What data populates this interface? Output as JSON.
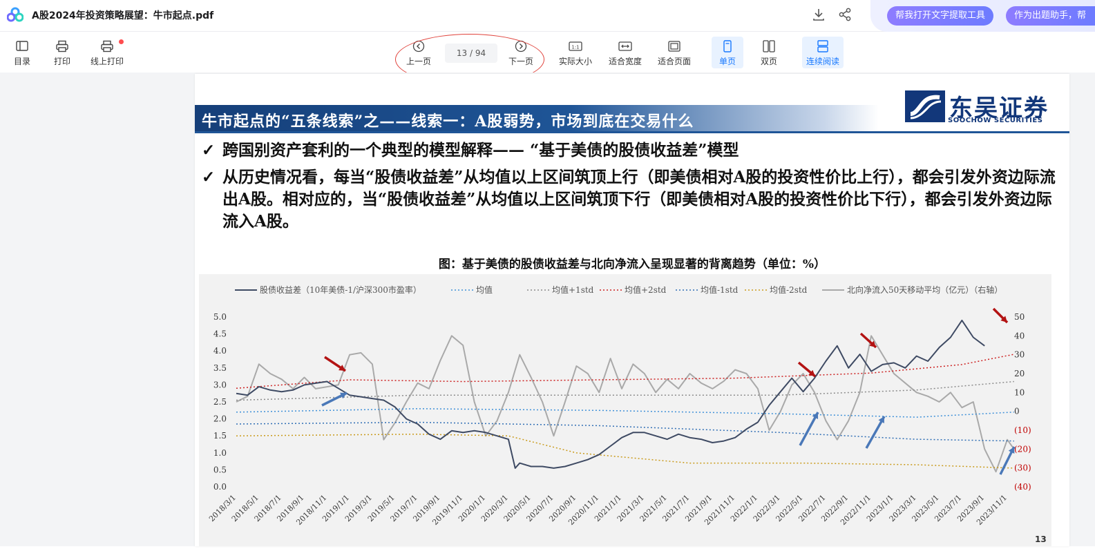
{
  "app": {
    "doc_title": "A股2024年投资策略展望：牛市起点.pdf"
  },
  "top_actions": {
    "assist_text_tool": "帮我打开文字提取工具",
    "assist_question": "作为出题助手，帮"
  },
  "toolbar": {
    "toc": "目录",
    "print": "打印",
    "online_print": "线上打印",
    "prev": "上一页",
    "page_indicator": "13 / 94",
    "next": "下一页",
    "actual_size": "实际大小",
    "fit_width": "适合宽度",
    "fit_page": "适合页面",
    "single": "单页",
    "double": "双页",
    "continuous": "连续阅读"
  },
  "slide": {
    "banner": "牛市起点的“五条线索”之——线索一：A股弱势，市场到底在交易什么",
    "brand_name": "东吴证券",
    "brand_en": "SOOCHOW SECURITIES",
    "check": "✓",
    "bullet1": "跨国别资产套利的一个典型的模型解释——  “基于美债的股债收益差”模型",
    "bullet2": "从历史情况看，每当“股债收益差”从均值以上区间筑顶上行（即美债相对A股的投资性价比上行），都会引发外资边际流出A股。相对应的，当“股债收益差”从均值以上区间筑顶下行（即美债相对A股的投资性价比下行），都会引发外资边际流入A股。",
    "fig_title": "图：基于美债的股债收益差与北向净流入呈现显著的背离趋势（单位：%）",
    "page_num": "13"
  },
  "colors": {
    "ebp": "#3e4a63",
    "mean": "#3c8fd8",
    "p1": "#8a8a8a",
    "p2": "#cc1f1f",
    "m1": "#2e6db4",
    "m2": "#c99a1a",
    "flow": "#a9a9a9",
    "red_arrow": "#b31313",
    "blue_arrow": "#4a78b8",
    "neg_tick": "#c00000"
  },
  "chart_data": {
    "type": "line",
    "legend": [
      "股债收益差（10年美债-1/沪深300市盈率）",
      "均值",
      "均值+1std",
      "均值+2std",
      "均值-1std",
      "均值-2std",
      "北向净流入50天移动平均（亿元）（右轴）"
    ],
    "x_ticks": [
      "2018/3/1",
      "2018/5/1",
      "2018/7/1",
      "2018/9/1",
      "2018/11/1",
      "2019/1/1",
      "2019/3/1",
      "2019/5/1",
      "2019/7/1",
      "2019/9/1",
      "2019/11/1",
      "2020/1/1",
      "2020/3/1",
      "2020/5/1",
      "2020/7/1",
      "2020/9/1",
      "2020/11/1",
      "2021/1/1",
      "2021/3/1",
      "2021/5/1",
      "2021/7/1",
      "2021/9/1",
      "2021/11/1",
      "2022/1/1",
      "2022/3/1",
      "2022/5/1",
      "2022/7/1",
      "2022/9/1",
      "2022/11/1",
      "2023/1/1",
      "2023/3/1",
      "2023/5/1",
      "2023/7/1",
      "2023/9/1",
      "2023/11/1"
    ],
    "left_ticks": [
      "0.0",
      "0.5",
      "1.0",
      "1.5",
      "2.0",
      "2.5",
      "3.0",
      "3.5",
      "4.0",
      "4.5",
      "5.0"
    ],
    "right_ticks": [
      "(40)",
      "(30)",
      "(20)",
      "(10)",
      "0",
      "10",
      "20",
      "30",
      "40",
      "50"
    ],
    "ylim_left": [
      0,
      5
    ],
    "ylim_right": [
      -40,
      50
    ],
    "series": [
      {
        "name": "股债收益差（10年美债-1/沪深300市盈率）",
        "axis": "left",
        "color": "#3e4a63",
        "width": 2,
        "t": [
          0,
          0.5,
          1,
          1.5,
          2,
          2.5,
          3,
          3.5,
          4,
          4.5,
          5,
          5.5,
          6,
          6.5,
          7,
          7.5,
          8,
          8.5,
          9,
          9.5,
          10,
          10.5,
          11,
          11.5,
          12,
          12.3,
          12.5,
          13,
          13.5,
          14,
          14.5,
          15,
          15.5,
          16,
          16.5,
          17,
          17.5,
          18,
          18.5,
          19,
          19.5,
          20,
          20.5,
          21,
          21.5,
          22,
          22.5,
          23,
          23.5,
          24,
          24.5,
          25,
          25.5,
          26,
          26.5,
          27,
          27.5,
          28,
          28.5,
          29,
          29.5,
          30,
          30.5,
          31,
          31.5,
          32,
          32.5,
          33,
          33.5,
          34,
          34.3
        ],
        "v": [
          2.75,
          2.7,
          2.95,
          2.85,
          2.8,
          2.85,
          3.0,
          3.05,
          3.1,
          2.9,
          2.7,
          2.65,
          2.6,
          2.55,
          2.35,
          2.0,
          1.85,
          1.55,
          1.4,
          1.65,
          1.6,
          1.65,
          1.6,
          1.5,
          1.4,
          0.55,
          0.7,
          0.6,
          0.6,
          0.55,
          0.6,
          0.7,
          0.8,
          0.95,
          1.2,
          1.45,
          1.6,
          1.6,
          1.5,
          1.4,
          1.55,
          1.45,
          1.4,
          1.3,
          1.35,
          1.45,
          1.7,
          1.9,
          2.4,
          2.8,
          3.2,
          2.8,
          3.2,
          3.7,
          4.15,
          3.5,
          3.9,
          3.4,
          3.6,
          3.65,
          3.5,
          3.85,
          3.7,
          4.1,
          4.4,
          4.9,
          4.4,
          4.15
        ]
      },
      {
        "name": "均值",
        "axis": "left",
        "color": "#3c8fd8",
        "dash": "2,3",
        "t": [
          0,
          8,
          16,
          24,
          30,
          34.3
        ],
        "v": [
          2.2,
          2.3,
          2.25,
          2.15,
          2.05,
          2.2
        ]
      },
      {
        "name": "均值+1std",
        "axis": "left",
        "color": "#8a8a8a",
        "dash": "2,3",
        "t": [
          0,
          8,
          16,
          24,
          30,
          34.3
        ],
        "v": [
          2.55,
          2.7,
          2.7,
          2.7,
          2.85,
          3.1
        ]
      },
      {
        "name": "均值+2std",
        "axis": "left",
        "color": "#cc1f1f",
        "dash": "2,3",
        "t": [
          0,
          5,
          10,
          16,
          22,
          28,
          32,
          34.3
        ],
        "v": [
          2.9,
          3.15,
          3.1,
          3.15,
          3.2,
          3.35,
          3.6,
          3.9
        ]
      },
      {
        "name": "均值-1std",
        "axis": "left",
        "color": "#2e6db4",
        "dash": "2,3",
        "t": [
          0,
          8,
          16,
          24,
          30,
          34.3
        ],
        "v": [
          1.85,
          1.9,
          1.8,
          1.6,
          1.4,
          1.35
        ]
      },
      {
        "name": "均值-2std",
        "axis": "left",
        "color": "#c99a1a",
        "dash": "2,3",
        "t": [
          0,
          8,
          12,
          15,
          20,
          25,
          30,
          34.3
        ],
        "v": [
          1.5,
          1.55,
          1.5,
          1.0,
          0.7,
          0.7,
          0.65,
          0.55
        ]
      },
      {
        "name": "北向净流入50天移动平均（亿元）（右轴）",
        "axis": "right",
        "color": "#a9a9a9",
        "width": 2,
        "t": [
          0,
          0.5,
          1,
          1.5,
          2,
          2.5,
          3,
          3.5,
          4,
          4.5,
          5,
          5.5,
          6,
          6.5,
          7,
          7.5,
          8,
          8.5,
          9,
          9.5,
          10,
          10.5,
          11,
          11.5,
          12,
          12.5,
          13,
          13.5,
          14,
          14.5,
          15,
          15.5,
          16,
          16.5,
          17,
          17.5,
          18,
          18.5,
          19,
          19.5,
          20,
          20.5,
          21,
          21.5,
          22,
          22.5,
          23,
          23.5,
          24,
          24.5,
          25,
          25.5,
          26,
          26.5,
          27,
          27.5,
          28,
          28.5,
          29,
          29.5,
          30,
          30.5,
          31,
          31.5,
          32,
          32.5,
          33,
          33.5,
          34,
          34.3
        ],
        "v": [
          5,
          8,
          25,
          20,
          17,
          12,
          18,
          12,
          13,
          14,
          30,
          31,
          25,
          -15,
          -6,
          5,
          15,
          12,
          27,
          40,
          35,
          5,
          -13,
          -5,
          10,
          30,
          18,
          5,
          -13,
          5,
          24,
          20,
          10,
          28,
          12,
          25,
          20,
          10,
          17,
          12,
          20,
          15,
          12,
          16,
          22,
          20,
          12,
          -10,
          0,
          14,
          20,
          10,
          -5,
          -15,
          -5,
          10,
          40,
          30,
          20,
          15,
          10,
          8,
          5,
          10,
          2,
          5,
          -20,
          -32,
          -15,
          -20
        ]
      }
    ]
  }
}
